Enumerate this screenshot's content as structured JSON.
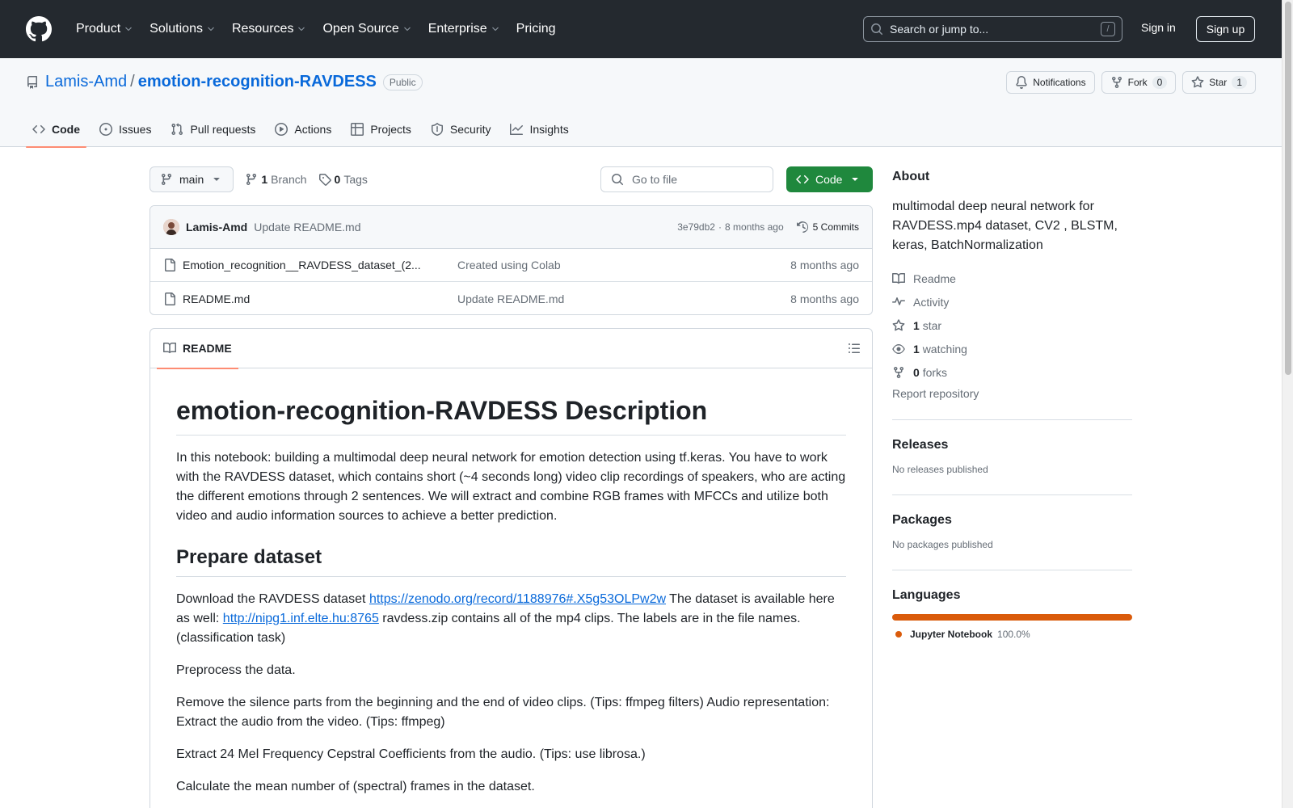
{
  "header": {
    "nav": [
      "Product",
      "Solutions",
      "Resources",
      "Open Source",
      "Enterprise",
      "Pricing"
    ],
    "search_placeholder": "Search or jump to...",
    "search_key": "/",
    "sign_in": "Sign in",
    "sign_up": "Sign up"
  },
  "repo": {
    "owner": "Lamis-Amd",
    "separator": "/",
    "name": "emotion-recognition-RAVDESS",
    "visibility": "Public",
    "notifications_label": "Notifications",
    "fork_label": "Fork",
    "fork_count": "0",
    "star_label": "Star",
    "star_count": "1",
    "tabs": [
      "Code",
      "Issues",
      "Pull requests",
      "Actions",
      "Projects",
      "Security",
      "Insights"
    ]
  },
  "branchbar": {
    "branch": "main",
    "branch_count": "1",
    "branch_label": "Branch",
    "tag_count": "0",
    "tag_label": "Tags",
    "goto_placeholder": "Go to file",
    "code_label": "Code"
  },
  "commit": {
    "author": "Lamis-Amd",
    "message": "Update README.md",
    "hash": "3e79db2",
    "dot": "·",
    "time": "8 months ago",
    "commits_label": "5 Commits"
  },
  "files": [
    {
      "name": "Emotion_recognition__RAVDESS_dataset_(2...",
      "message": "Created using Colab",
      "date": "8 months ago"
    },
    {
      "name": "README.md",
      "message": "Update README.md",
      "date": "8 months ago"
    }
  ],
  "readme": {
    "tab_label": "README",
    "h1": "emotion-recognition-RAVDESS Description",
    "p1": "In this notebook: building a multimodal deep neural network for emotion detection using tf.keras. You have to work with the RAVDESS dataset, which contains short (~4 seconds long) video clip recordings of speakers, who are acting the different emotions through 2 sentences. We will extract and combine RGB frames with MFCCs and utilize both video and audio information sources to achieve a better prediction.",
    "h2": "Prepare dataset",
    "p2_pre": "Download the RAVDESS dataset ",
    "p2_link1": "https://zenodo.org/record/1188976#.X5g53OLPw2w",
    "p2_mid": " The dataset is available here as well: ",
    "p2_link2": "http://nipg1.inf.elte.hu:8765",
    "p2_post": " ravdess.zip contains all of the mp4 clips. The labels are in the file names. (classification task)",
    "p3": "Preprocess the data.",
    "p4": "Remove the silence parts from the beginning and the end of video clips. (Tips: ffmpeg filters) Audio representation: Extract the audio from the video. (Tips: ffmpeg)",
    "p5": "Extract 24 Mel Frequency Cepstral Coefficients from the audio. (Tips: use librosa.)",
    "p6": "Calculate the mean number of (spectral) frames in the dataset."
  },
  "sidebar": {
    "about_title": "About",
    "about_desc": "multimodal deep neural network for RAVDESS.mp4 dataset, CV2 , BLSTM, keras, BatchNormalization",
    "readme_label": "Readme",
    "activity_label": "Activity",
    "stars_count": "1",
    "stars_label": "star",
    "watching_count": "1",
    "watching_label": "watching",
    "forks_count": "0",
    "forks_label": "forks",
    "report_label": "Report repository",
    "releases_title": "Releases",
    "releases_empty": "No releases published",
    "packages_title": "Packages",
    "packages_empty": "No packages published",
    "languages_title": "Languages",
    "language_name": "Jupyter Notebook",
    "language_pct": "100.0%",
    "language_color": "#da5b0b"
  },
  "colors": {
    "header_bg": "#24292f",
    "link": "#0969da",
    "code_button": "#1f883d",
    "active_tab_underline": "#fd8c73"
  }
}
